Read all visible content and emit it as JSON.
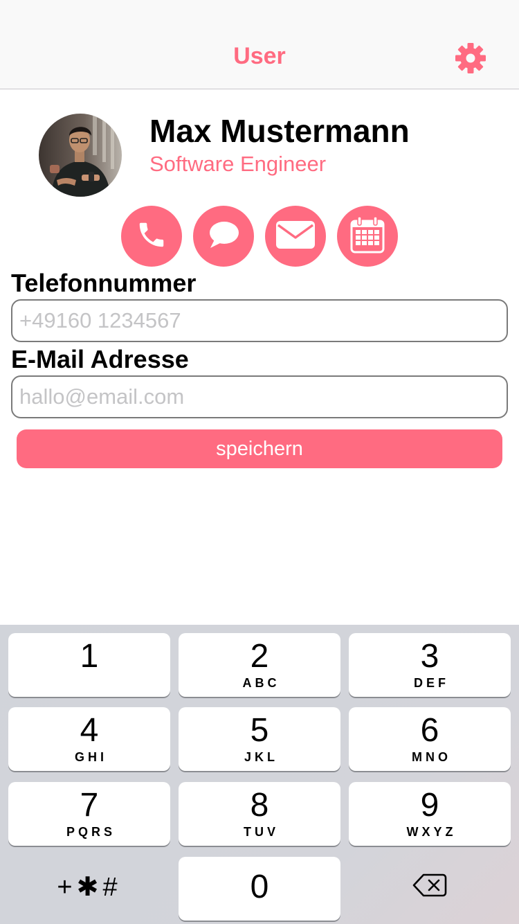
{
  "navbar": {
    "title": "User",
    "settings_icon": "gear-icon"
  },
  "profile": {
    "name": "Max Mustermann",
    "role": "Software Engineer"
  },
  "actions": [
    {
      "icon": "phone-icon"
    },
    {
      "icon": "message-icon"
    },
    {
      "icon": "mail-icon"
    },
    {
      "icon": "calendar-icon"
    }
  ],
  "form": {
    "phone_label": "Telefonnummer",
    "phone_placeholder": "+49160 1234567",
    "phone_value": "",
    "email_label": "E-Mail Adresse",
    "email_placeholder": "hallo@email.com",
    "email_value": "",
    "save_label": "speichern"
  },
  "keypad": {
    "keys": [
      {
        "digit": "1",
        "letters": ""
      },
      {
        "digit": "2",
        "letters": "ABC"
      },
      {
        "digit": "3",
        "letters": "DEF"
      },
      {
        "digit": "4",
        "letters": "GHI"
      },
      {
        "digit": "5",
        "letters": "JKL"
      },
      {
        "digit": "6",
        "letters": "MNO"
      },
      {
        "digit": "7",
        "letters": "PQRS"
      },
      {
        "digit": "8",
        "letters": "TUV"
      },
      {
        "digit": "9",
        "letters": "WXYZ"
      }
    ],
    "zero": "0",
    "symbols": "+✱#",
    "delete_icon": "backspace-icon"
  },
  "colors": {
    "accent": "#ff6b81",
    "keypad_bg": "#d1d4da"
  }
}
